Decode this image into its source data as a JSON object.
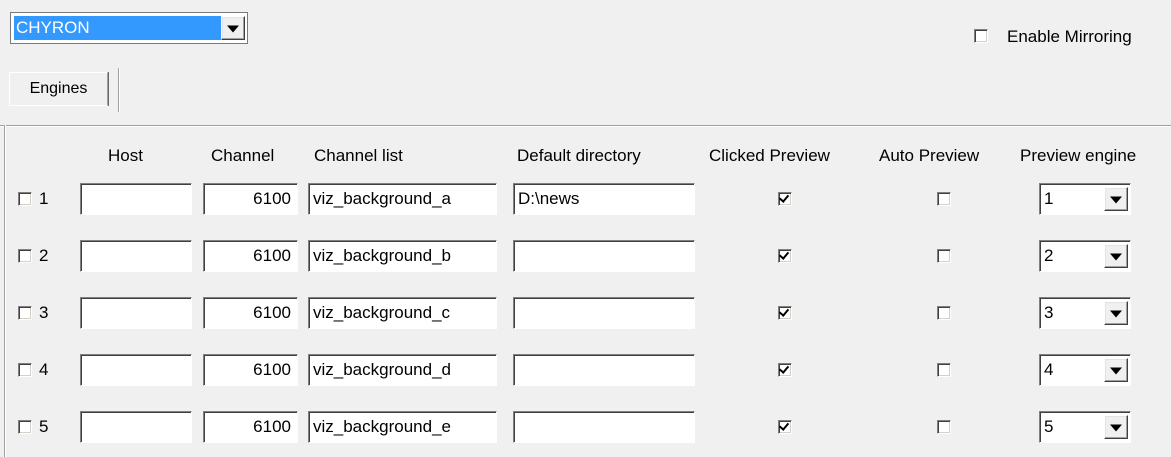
{
  "top": {
    "selector_value": "CHYRON",
    "enable_mirroring_label": "Enable Mirroring",
    "enable_mirroring_checked": false
  },
  "tabs": [
    {
      "label": "Engines"
    }
  ],
  "headers": {
    "host": "Host",
    "channel": "Channel",
    "channel_list": "Channel list",
    "default_directory": "Default directory",
    "clicked_preview": "Clicked Preview",
    "auto_preview": "Auto Preview",
    "preview_engine": "Preview engine"
  },
  "rows": [
    {
      "num": "1",
      "host": "",
      "channel": "6100",
      "channel_list": "viz_background_a",
      "default_directory": "D:\\news",
      "clicked_preview": true,
      "auto_preview": false,
      "preview_engine": "1",
      "enabled": false
    },
    {
      "num": "2",
      "host": "",
      "channel": "6100",
      "channel_list": "viz_background_b",
      "default_directory": "",
      "clicked_preview": true,
      "auto_preview": false,
      "preview_engine": "2",
      "enabled": false
    },
    {
      "num": "3",
      "host": "",
      "channel": "6100",
      "channel_list": "viz_background_c",
      "default_directory": "",
      "clicked_preview": true,
      "auto_preview": false,
      "preview_engine": "3",
      "enabled": false
    },
    {
      "num": "4",
      "host": "",
      "channel": "6100",
      "channel_list": "viz_background_d",
      "default_directory": "",
      "clicked_preview": true,
      "auto_preview": false,
      "preview_engine": "4",
      "enabled": false
    },
    {
      "num": "5",
      "host": "",
      "channel": "6100",
      "channel_list": "viz_background_e",
      "default_directory": "",
      "clicked_preview": true,
      "auto_preview": false,
      "preview_engine": "5",
      "enabled": false
    }
  ],
  "colors": {
    "selection": "#3399ff",
    "background": "#f0f0f0"
  }
}
